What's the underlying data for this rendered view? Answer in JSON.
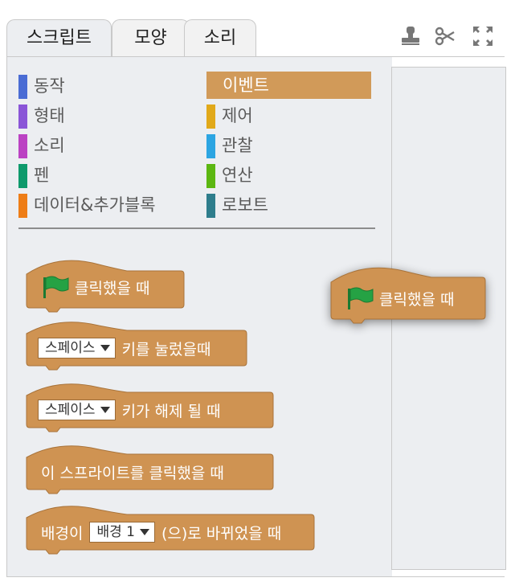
{
  "tabs": [
    {
      "label": "스크립트",
      "active": true
    },
    {
      "label": "모양",
      "active": false
    },
    {
      "label": "소리",
      "active": false
    }
  ],
  "tools": [
    "stamp-icon",
    "scissors-icon",
    "fullscreen-icon"
  ],
  "categories": [
    {
      "label": "동작",
      "color": "#4a6cd4"
    },
    {
      "label": "형태",
      "color": "#8a55d7"
    },
    {
      "label": "소리",
      "color": "#bb42c3"
    },
    {
      "label": "펜",
      "color": "#0e9a6c"
    },
    {
      "label": "데이터&추가블록",
      "color": "#ee7d16"
    },
    {
      "label": "이벤트",
      "color": "#c88330",
      "selected": true
    },
    {
      "label": "제어",
      "color": "#e1a91a"
    },
    {
      "label": "관찰",
      "color": "#2ca5e2"
    },
    {
      "label": "연산",
      "color": "#5cb712"
    },
    {
      "label": "로보트",
      "color": "#2e7d8c"
    }
  ],
  "blocks": {
    "when_flag": {
      "text": "클릭했을 때"
    },
    "when_key_pressed": {
      "dropdown": "스페이스",
      "text": "키를 눌렀을때"
    },
    "when_key_released": {
      "dropdown": "스페이스",
      "text": "키가 해제 될 때"
    },
    "when_sprite_clicked": {
      "text": "이 스프라이트를 클릭했을 때"
    },
    "when_backdrop_switches": {
      "prefix": "배경이",
      "dropdown": "배경 1",
      "text": "(으)로 바뀌었을 때"
    }
  },
  "script_area": {
    "block": {
      "text": "클릭했을 때"
    }
  },
  "colors": {
    "block": "#cf9352",
    "block_edge": "#a8733a",
    "flag": "#25a244",
    "selected_category": "#d19a59"
  }
}
